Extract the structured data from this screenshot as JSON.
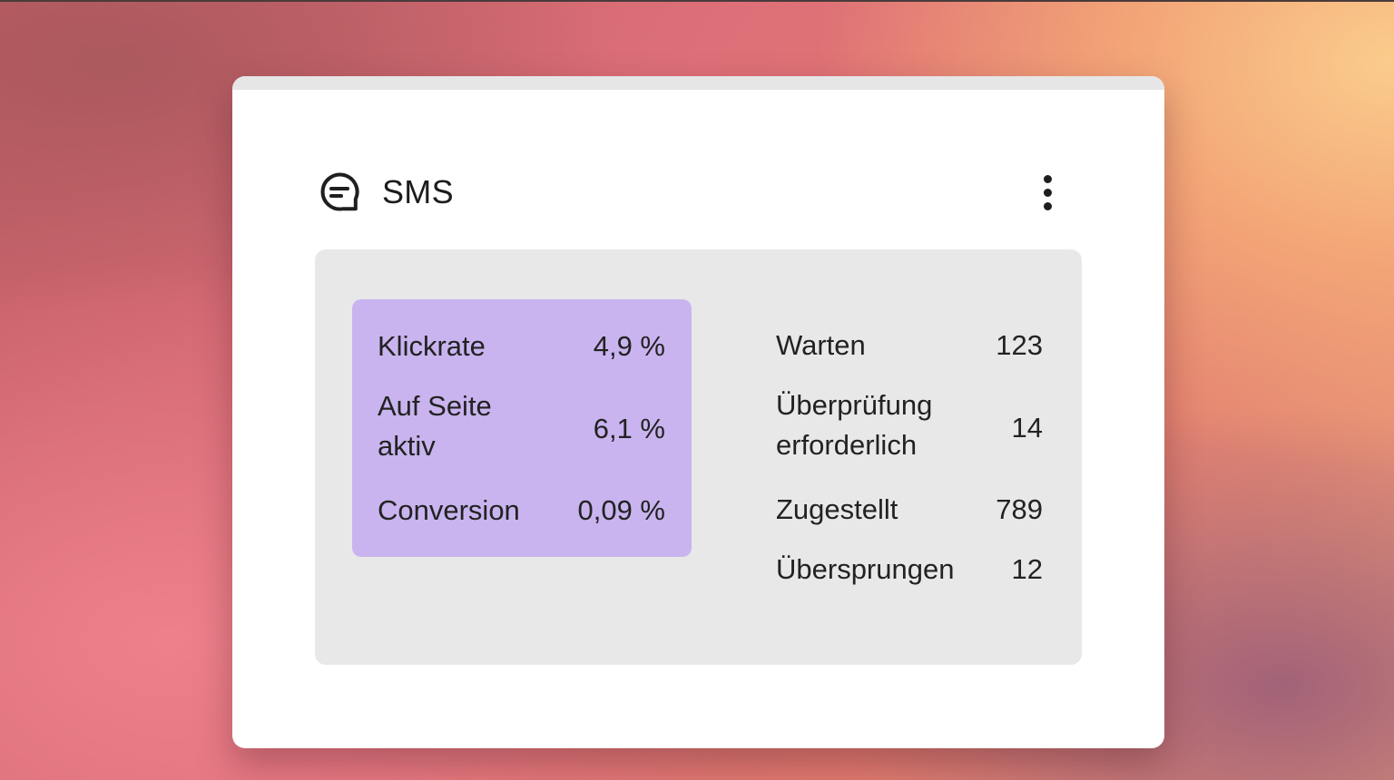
{
  "card": {
    "title": "SMS",
    "icon": "chat-bubble-icon",
    "menu_icon": "more-vertical-icon"
  },
  "rates": [
    {
      "label": "Klickrate",
      "value": "4,9 %"
    },
    {
      "label": "Auf Seite aktiv",
      "value": "6,1 %"
    },
    {
      "label": "Conversion",
      "value": "0,09 %"
    }
  ],
  "counts": [
    {
      "label": "Warten",
      "value": "123"
    },
    {
      "label": "Überprüfung erforderlich",
      "value": "14"
    },
    {
      "label": "Zugestellt",
      "value": "789"
    },
    {
      "label": "Übersprungen",
      "value": "12"
    }
  ],
  "colors": {
    "highlight": "#c9b4ef",
    "panel": "#e8e8e8",
    "card": "#ffffff"
  }
}
